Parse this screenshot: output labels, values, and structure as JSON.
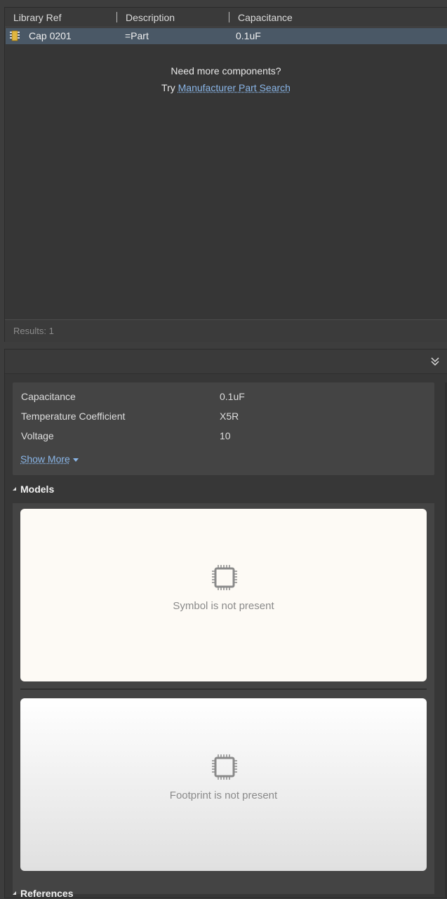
{
  "results_table": {
    "columns": [
      "Library Ref",
      "Description",
      "Capacitance"
    ],
    "rows": [
      {
        "library_ref": "Cap 0201",
        "description": "=Part",
        "capacitance": "0.1uF",
        "icon": "component-chip-icon"
      }
    ],
    "empty_line1": "Need more components?",
    "empty_try": "Try",
    "empty_link": "Manufacturer Part Search",
    "results_label": "Results: 1"
  },
  "properties": {
    "rows": [
      {
        "name": "Capacitance",
        "value": "0.1uF"
      },
      {
        "name": "Temperature Coefficient",
        "value": "X5R"
      },
      {
        "name": "Voltage",
        "value": "10"
      }
    ],
    "show_more": "Show More"
  },
  "models": {
    "title": "Models",
    "symbol_text": "Symbol is not present",
    "footprint_text": "Footprint is not present"
  },
  "references": {
    "title": "References"
  },
  "colors": {
    "selection": "#4a5866",
    "link": "#8ab6e8",
    "panel": "#373737"
  }
}
